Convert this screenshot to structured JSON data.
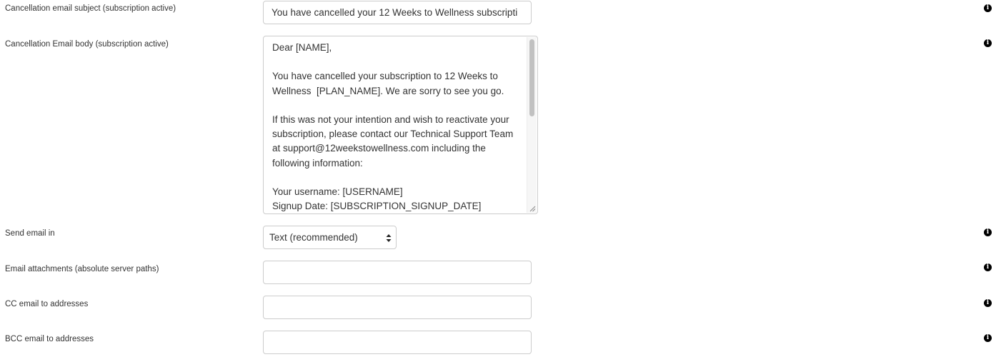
{
  "fields": {
    "subject": {
      "label": "Cancellation email subject (subscription active)",
      "value": "You have cancelled your 12 Weeks to Wellness subscripti"
    },
    "body": {
      "label": "Cancellation Email body (subscription active)",
      "value": "Dear [NAME],\n\nYou have cancelled your subscription to 12 Weeks to Wellness  [PLAN_NAME]. We are sorry to see you go.\n\nIf this was not your intention and wish to reactivate your subscription, please contact our Technical Support Team at support@12weekstowellness.com including the following information:\n\nYour username: [USERNAME]\nSignup Date: [SUBSCRIPTION_SIGNUP_DATE]\nLast Renewal Date:"
    },
    "format": {
      "label": "Send email in",
      "selected": "Text (recommended)"
    },
    "attachments": {
      "label": "Email attachments (absolute server paths)",
      "value": ""
    },
    "cc": {
      "label": "CC email to addresses",
      "value": ""
    },
    "bcc": {
      "label": "BCC email to addresses",
      "value": ""
    }
  },
  "icons": {
    "info": "info-icon",
    "info_glyph": "i"
  }
}
